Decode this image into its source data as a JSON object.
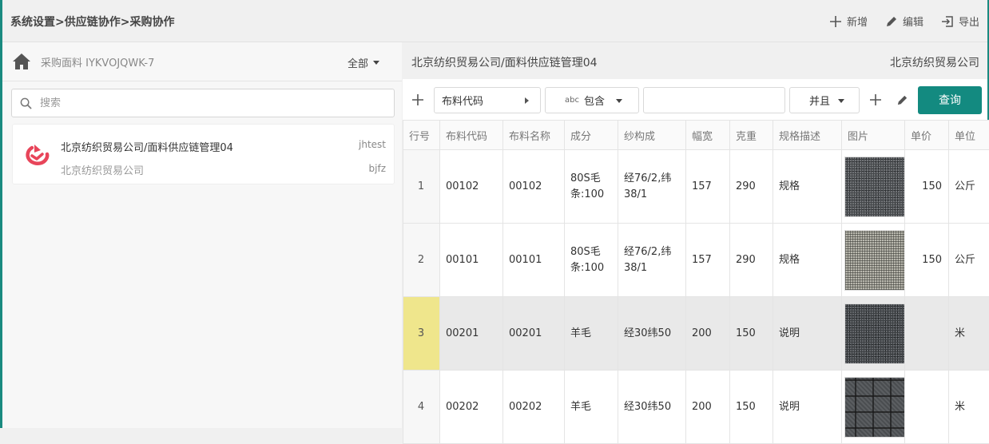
{
  "topbar": {
    "breadcrumb": "系统设置>供应链协作>采购协作",
    "actions": {
      "add": "新增",
      "edit": "编辑",
      "export": "导出"
    }
  },
  "left": {
    "title": "采购面料 IYKVOJQWK-7",
    "filter": "全部",
    "search_placeholder": "搜索",
    "card": {
      "name": "北京纺织贸易公司/面料供应链管理04",
      "company": "北京纺织贸易公司",
      "tag1": "jhtest",
      "tag2": "bjfz"
    }
  },
  "right": {
    "title": "北京纺织贸易公司/面料供应链管理04",
    "company": "北京纺织贸易公司",
    "filterbar": {
      "field": "布料代码",
      "operator": "包含",
      "operator_icon": "abc",
      "value": "",
      "logic": "并且",
      "query_label": "查询"
    },
    "columns": [
      "行号",
      "布料代码",
      "布料名称",
      "成分",
      "纱构成",
      "幅宽",
      "克重",
      "规格描述",
      "图片",
      "单价",
      "单位"
    ],
    "rows": [
      {
        "rn": "1",
        "code": "00102",
        "name": "00102",
        "comp": "80S毛条:100",
        "yarn": "经76/2,纬38/1",
        "width": "157",
        "weight": "290",
        "spec": "规格",
        "img": "dark-grey-tweed",
        "price": "150",
        "unit": "公斤"
      },
      {
        "rn": "2",
        "code": "00101",
        "name": "00101",
        "comp": "80S毛条:100",
        "yarn": "经76/2,纬38/1",
        "width": "157",
        "weight": "290",
        "spec": "规格",
        "img": "light-grey-weave",
        "price": "150",
        "unit": "公斤"
      },
      {
        "rn": "3",
        "code": "00201",
        "name": "00201",
        "comp": "羊毛",
        "yarn": "经30纬50",
        "width": "200",
        "weight": "150",
        "spec": "说明",
        "img": "dark-grey-tweed",
        "price": "",
        "unit": "米"
      },
      {
        "rn": "4",
        "code": "00202",
        "name": "00202",
        "comp": "羊毛",
        "yarn": "经30纬50",
        "width": "200",
        "weight": "150",
        "spec": "说明",
        "img": "grey-plaid",
        "price": "",
        "unit": "米"
      }
    ]
  },
  "colors": {
    "accent": "#138a80",
    "selected_row_number": "#efe68c",
    "selected_row": "#e9e9e9",
    "logo": "#e8455a"
  }
}
